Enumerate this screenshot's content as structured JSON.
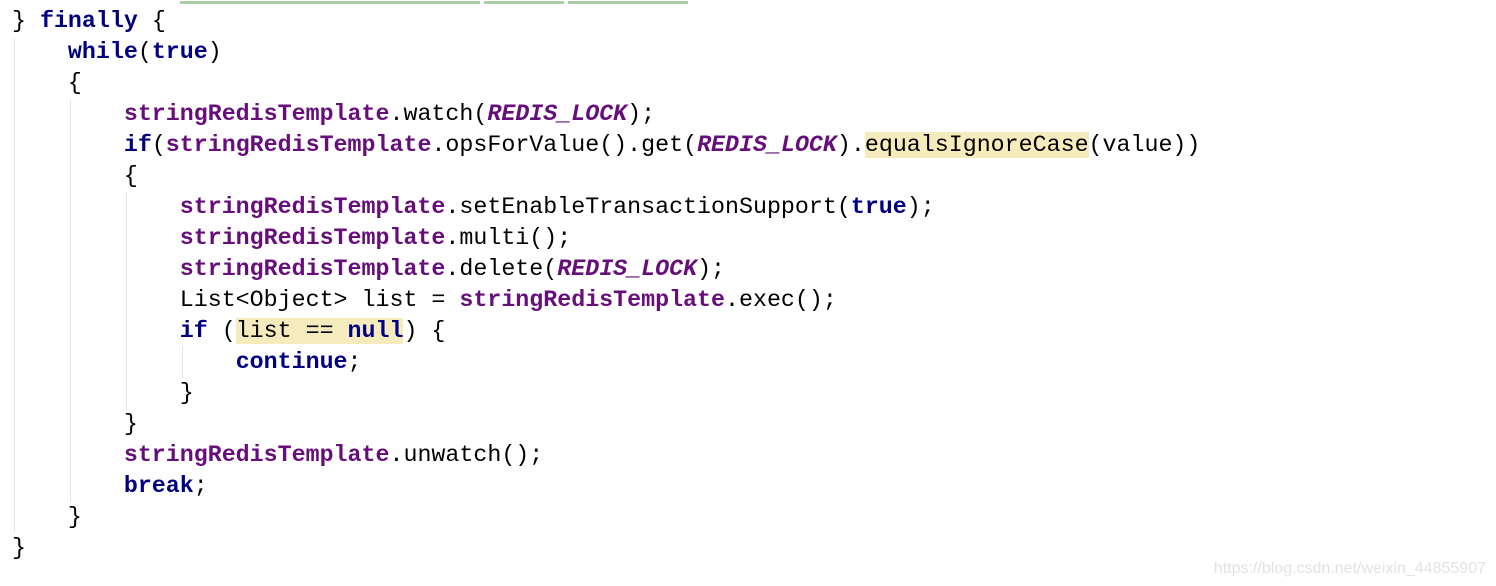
{
  "editor": {
    "colors": {
      "keyword": "#000080",
      "field": "#660e7a",
      "highlight": "#f6ebbc"
    },
    "lines": [
      {
        "indent": 0,
        "tokens": [
          [
            "p",
            "} "
          ],
          [
            "k",
            "finally"
          ],
          [
            "p",
            " {"
          ]
        ]
      },
      {
        "indent": 1,
        "tokens": [
          [
            "k",
            "while"
          ],
          [
            "p",
            "("
          ],
          [
            "k",
            "true"
          ],
          [
            "p",
            ")"
          ]
        ]
      },
      {
        "indent": 1,
        "tokens": [
          [
            "p",
            "{"
          ]
        ]
      },
      {
        "indent": 2,
        "tokens": [
          [
            "f",
            "stringRedisTemplate"
          ],
          [
            "p",
            ".watch("
          ],
          [
            "c",
            "REDIS_LOCK"
          ],
          [
            "p",
            ");"
          ]
        ]
      },
      {
        "indent": 2,
        "tokens": [
          [
            "k",
            "if"
          ],
          [
            "p",
            "("
          ],
          [
            "f",
            "stringRedisTemplate"
          ],
          [
            "p",
            ".opsForValue().get("
          ],
          [
            "c",
            "REDIS_LOCK"
          ],
          [
            "p",
            ")."
          ],
          [
            "hp",
            "equalsIgnoreCase"
          ],
          [
            "p",
            "(value))"
          ]
        ]
      },
      {
        "indent": 2,
        "tokens": [
          [
            "p",
            "{"
          ]
        ]
      },
      {
        "indent": 3,
        "tokens": [
          [
            "f",
            "stringRedisTemplate"
          ],
          [
            "p",
            ".setEnableTransactionSupport("
          ],
          [
            "k",
            "true"
          ],
          [
            "p",
            ");"
          ]
        ]
      },
      {
        "indent": 3,
        "tokens": [
          [
            "f",
            "stringRedisTemplate"
          ],
          [
            "p",
            ".multi();"
          ]
        ]
      },
      {
        "indent": 3,
        "tokens": [
          [
            "f",
            "stringRedisTemplate"
          ],
          [
            "p",
            ".delete("
          ],
          [
            "c",
            "REDIS_LOCK"
          ],
          [
            "p",
            ");"
          ]
        ]
      },
      {
        "indent": 3,
        "tokens": [
          [
            "p",
            "List<Object> list = "
          ],
          [
            "f",
            "stringRedisTemplate"
          ],
          [
            "p",
            ".exec();"
          ]
        ]
      },
      {
        "indent": 3,
        "tokens": [
          [
            "k",
            "if"
          ],
          [
            "p",
            " ("
          ],
          [
            "hp",
            "list == "
          ],
          [
            "hk",
            "null"
          ],
          [
            "p",
            ") {"
          ]
        ]
      },
      {
        "indent": 4,
        "tokens": [
          [
            "k",
            "continue"
          ],
          [
            "p",
            ";"
          ]
        ]
      },
      {
        "indent": 3,
        "tokens": [
          [
            "p",
            "}"
          ]
        ]
      },
      {
        "indent": 2,
        "tokens": [
          [
            "p",
            "}"
          ]
        ]
      },
      {
        "indent": 2,
        "tokens": [
          [
            "f",
            "stringRedisTemplate"
          ],
          [
            "p",
            ".unwatch();"
          ]
        ]
      },
      {
        "indent": 2,
        "tokens": [
          [
            "k",
            "break"
          ],
          [
            "p",
            ";"
          ]
        ]
      },
      {
        "indent": 1,
        "tokens": [
          [
            "p",
            "}"
          ]
        ]
      },
      {
        "indent": 0,
        "tokens": [
          [
            "p",
            "}"
          ]
        ]
      }
    ]
  },
  "watermark": "https://blog.csdn.net/weixin_44855907"
}
